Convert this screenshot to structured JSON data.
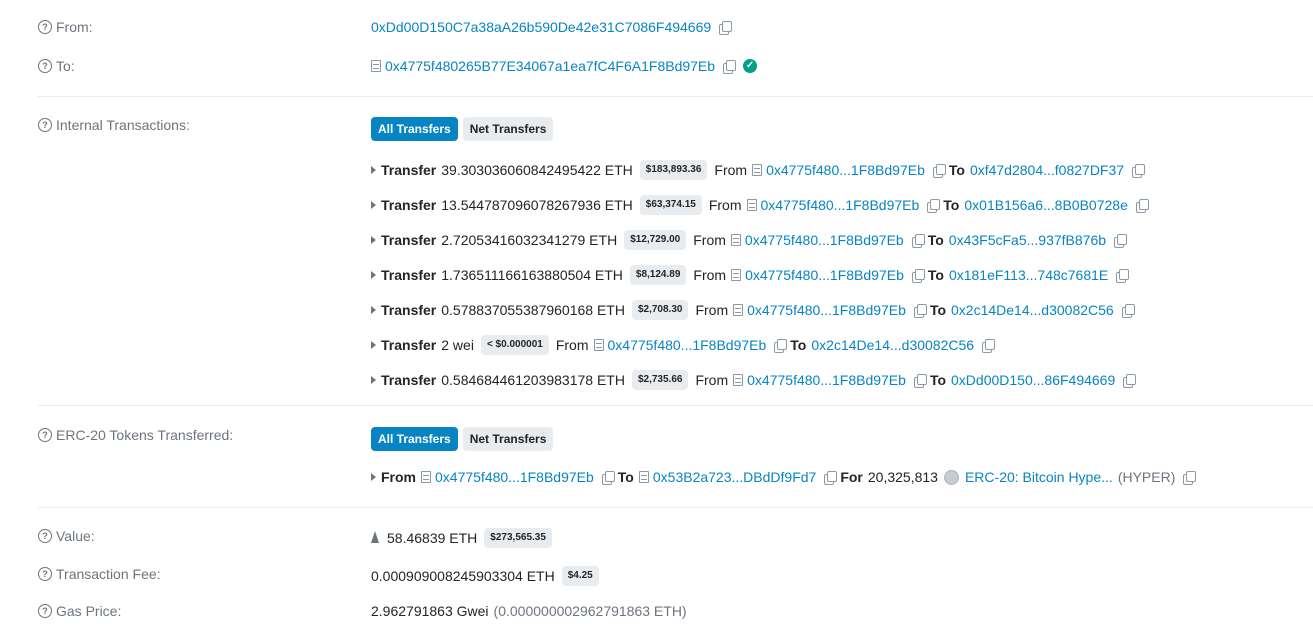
{
  "from": {
    "label": "From:",
    "address": "0xDd00D150C7a38aA26b590De42e31C7086F494669"
  },
  "to": {
    "label": "To:",
    "address": "0x4775f480265B77E34067a1ea7fC4F6A1F8Bd97Eb"
  },
  "internal": {
    "label": "Internal Transactions:",
    "btn_all": "All Transfers",
    "btn_net": "Net Transfers",
    "transfers": [
      {
        "kw": "Transfer",
        "amount": "39.303036060842495422 ETH",
        "usd": "$183,893.36",
        "from_kw": "From",
        "from": "0x4775f480...1F8Bd97Eb",
        "to_kw": "To",
        "to": "0xf47d2804...f0827DF37"
      },
      {
        "kw": "Transfer",
        "amount": "13.544787096078267936 ETH",
        "usd": "$63,374.15",
        "from_kw": "From",
        "from": "0x4775f480...1F8Bd97Eb",
        "to_kw": "To",
        "to": "0x01B156a6...8B0B0728e"
      },
      {
        "kw": "Transfer",
        "amount": "2.72053416032341279 ETH",
        "usd": "$12,729.00",
        "from_kw": "From",
        "from": "0x4775f480...1F8Bd97Eb",
        "to_kw": "To",
        "to": "0x43F5cFa5...937fB876b"
      },
      {
        "kw": "Transfer",
        "amount": "1.736511166163880504 ETH",
        "usd": "$8,124.89",
        "from_kw": "From",
        "from": "0x4775f480...1F8Bd97Eb",
        "to_kw": "To",
        "to": "0x181eF113...748c7681E"
      },
      {
        "kw": "Transfer",
        "amount": "0.578837055387960168 ETH",
        "usd": "$2,708.30",
        "from_kw": "From",
        "from": "0x4775f480...1F8Bd97Eb",
        "to_kw": "To",
        "to": "0x2c14De14...d30082C56"
      },
      {
        "kw": "Transfer",
        "amount": "2 wei",
        "usd": "< $0.000001",
        "from_kw": "From",
        "from": "0x4775f480...1F8Bd97Eb",
        "to_kw": "To",
        "to": "0x2c14De14...d30082C56"
      },
      {
        "kw": "Transfer",
        "amount": "0.584684461203983178 ETH",
        "usd": "$2,735.66",
        "from_kw": "From",
        "from": "0x4775f480...1F8Bd97Eb",
        "to_kw": "To",
        "to": "0xDd00D150...86F494669"
      }
    ]
  },
  "erc20": {
    "label": "ERC-20 Tokens Transferred:",
    "btn_all": "All Transfers",
    "btn_net": "Net Transfers",
    "row": {
      "from_kw": "From",
      "from": "0x4775f480...1F8Bd97Eb",
      "to_kw": "To",
      "to": "0x53B2a723...DBdDf9Fd7",
      "for_kw": "For",
      "amount": "20,325,813",
      "token": "ERC-20: Bitcoin Hype...",
      "symbol": "(HYPER)"
    }
  },
  "value": {
    "label": "Value:",
    "amount": "58.46839 ETH",
    "usd": "$273,565.35"
  },
  "fee": {
    "label": "Transaction Fee:",
    "amount": "0.000909008245903304 ETH",
    "usd": "$4.25"
  },
  "gas": {
    "label": "Gas Price:",
    "amount": "2.962791863 Gwei",
    "eth": "(0.000000002962791863 ETH)"
  }
}
